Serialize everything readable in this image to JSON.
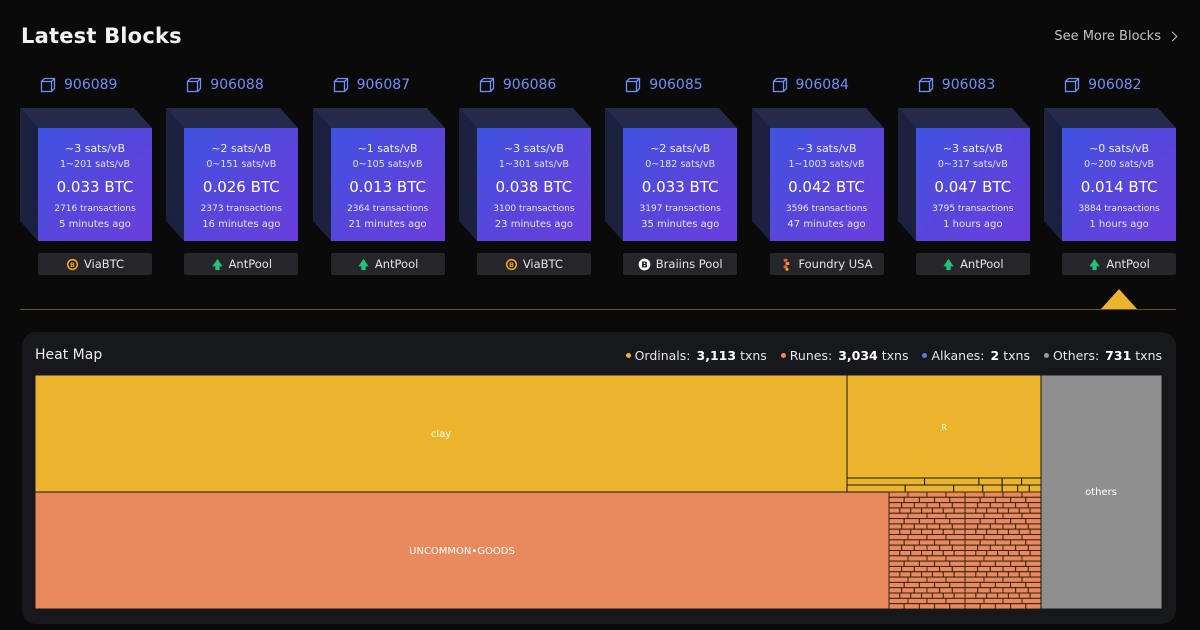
{
  "header": {
    "title": "Latest Blocks",
    "see_more": "See More Blocks"
  },
  "blocks": [
    {
      "height": "906089",
      "fee": "~3 sats/vB",
      "range": "1~201 sats/vB",
      "btc": "0.033 BTC",
      "tx": "2716 transactions",
      "ago": "5 minutes ago",
      "pool": "ViaBTC",
      "pool_icon": "viabtc-icon"
    },
    {
      "height": "906088",
      "fee": "~2 sats/vB",
      "range": "0~151 sats/vB",
      "btc": "0.026 BTC",
      "tx": "2373 transactions",
      "ago": "16 minutes ago",
      "pool": "AntPool",
      "pool_icon": "antpool-icon"
    },
    {
      "height": "906087",
      "fee": "~1 sats/vB",
      "range": "0~105 sats/vB",
      "btc": "0.013 BTC",
      "tx": "2364 transactions",
      "ago": "21 minutes ago",
      "pool": "AntPool",
      "pool_icon": "antpool-icon"
    },
    {
      "height": "906086",
      "fee": "~3 sats/vB",
      "range": "1~301 sats/vB",
      "btc": "0.038 BTC",
      "tx": "3100 transactions",
      "ago": "23 minutes ago",
      "pool": "ViaBTC",
      "pool_icon": "viabtc-icon"
    },
    {
      "height": "906085",
      "fee": "~2 sats/vB",
      "range": "0~182 sats/vB",
      "btc": "0.033 BTC",
      "tx": "3197 transactions",
      "ago": "35 minutes ago",
      "pool": "Braiins Pool",
      "pool_icon": "braiins-icon"
    },
    {
      "height": "906084",
      "fee": "~3 sats/vB",
      "range": "1~1003 sats/vB",
      "btc": "0.042 BTC",
      "tx": "3596 transactions",
      "ago": "47 minutes ago",
      "pool": "Foundry USA",
      "pool_icon": "foundry-icon"
    },
    {
      "height": "906083",
      "fee": "~3 sats/vB",
      "range": "0~317 sats/vB",
      "btc": "0.047 BTC",
      "tx": "3795 transactions",
      "ago": "1 hours ago",
      "pool": "AntPool",
      "pool_icon": "antpool-icon"
    },
    {
      "height": "906082",
      "fee": "~0 sats/vB",
      "range": "0~200 sats/vB",
      "btc": "0.014 BTC",
      "tx": "3884 transactions",
      "ago": "1 hours ago",
      "pool": "AntPool",
      "pool_icon": "antpool-icon"
    }
  ],
  "heatmap": {
    "title": "Heat Map",
    "legend": [
      {
        "label": "Ordinals:",
        "count": "3,113",
        "unit": "txns",
        "color": "#ebb42c"
      },
      {
        "label": "Runes:",
        "count": "3,034",
        "unit": "txns",
        "color": "#e88a5e"
      },
      {
        "label": "Alkanes:",
        "count": "2",
        "unit": "txns",
        "color": "#4f7ee8"
      },
      {
        "label": "Others:",
        "count": "731",
        "unit": "txns",
        "color": "#9a9a9a"
      }
    ],
    "tiles": {
      "clay": "clay",
      "r": "R",
      "uncommon_goods": "UNCOMMON•GOODS",
      "others": "others"
    }
  },
  "colors": {
    "ordinals": "#ebb42c",
    "runes": "#e88a5e",
    "others": "#8f8f8f",
    "accent": "#6f8ff5",
    "pointer": "#ebb42c"
  }
}
